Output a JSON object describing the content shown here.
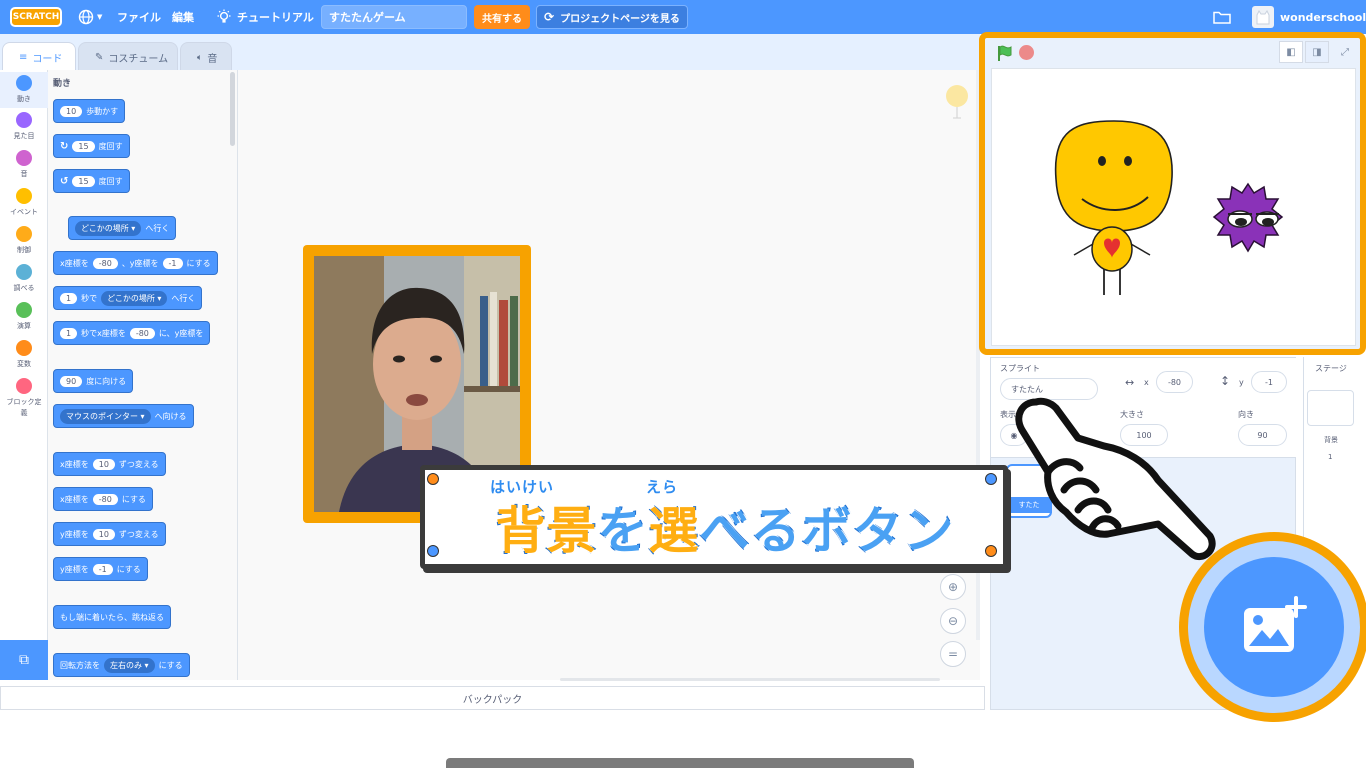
{
  "menubar": {
    "logo": "SCRATCH",
    "file": "ファイル",
    "edit": "編集",
    "tutorial": "チュートリアル",
    "project_title": "すたたんゲーム",
    "share": "共有する",
    "see_project_page": "プロジェクトページを見る",
    "username": "wonderschool"
  },
  "tabs": {
    "code": "コード",
    "costumes": "コスチューム",
    "sounds": "音"
  },
  "categories": [
    {
      "label": "動き",
      "color": "#4c97ff"
    },
    {
      "label": "見た目",
      "color": "#9966ff"
    },
    {
      "label": "音",
      "color": "#cf63cf"
    },
    {
      "label": "イベント",
      "color": "#ffbf00"
    },
    {
      "label": "制御",
      "color": "#ffab19"
    },
    {
      "label": "調べる",
      "color": "#5cb1d6"
    },
    {
      "label": "演算",
      "color": "#59c059"
    },
    {
      "label": "変数",
      "color": "#ff8c1a"
    },
    {
      "label": "ブロック定義",
      "color": "#ff6680"
    }
  ],
  "palette": {
    "heading": "動き",
    "move": {
      "n": "10",
      "t": "歩動かす"
    },
    "turn_right": {
      "n": "15",
      "t": "度回す"
    },
    "turn_left": {
      "n": "15",
      "t": "度回す"
    },
    "goto": {
      "d": "どこかの場所",
      "t": "へ行く"
    },
    "gotoxy": {
      "a": "x座標を",
      "x": "-80",
      "b": "、y座標を",
      "y": "-1",
      "c": "にする"
    },
    "glide": {
      "n": "1",
      "a": "秒で",
      "d": "どこかの場所",
      "t": "へ行く"
    },
    "glidexy": {
      "n": "1",
      "a": "秒でx座標を",
      "x": "-80",
      "b": "に、y座標を"
    },
    "point_dir": {
      "n": "90",
      "t": "度に向ける"
    },
    "point_towards": {
      "d": "マウスのポインター",
      "t": "へ向ける"
    },
    "change_x": {
      "a": "x座標を",
      "n": "10",
      "t": "ずつ変える"
    },
    "set_x": {
      "a": "x座標を",
      "n": "-80",
      "t": "にする"
    },
    "change_y": {
      "a": "y座標を",
      "n": "10",
      "t": "ずつ変える"
    },
    "set_y": {
      "a": "y座標を",
      "n": "-1",
      "t": "にする"
    },
    "bounce": "もし端に着いたら、跳ね返る",
    "rotation": {
      "a": "回転方法を",
      "d": "左右のみ",
      "t": "にする"
    }
  },
  "backpack": "バックパック",
  "sprite_info": {
    "sprite_label": "スプライト",
    "sprite_name": "すたたん",
    "x_label": "x",
    "x_value": "-80",
    "y_label": "y",
    "y_value": "-1",
    "show_label": "表示す",
    "size_label": "大きさ",
    "size_value": "100",
    "direction_label": "向き",
    "direction_value": "90",
    "tile_name": "すたた"
  },
  "stage_panel": {
    "label": "ステージ",
    "backdrops_label": "背景",
    "backdrops_count": "1"
  },
  "caption": {
    "ruby_1": "はいけい",
    "ruby_2": "えら",
    "part1": "背景",
    "part2": "を",
    "part3": "選",
    "part4": "べるボタン"
  },
  "colors": {
    "accent": "#4c97ff",
    "highlight": "#f7a200",
    "share": "#ff8c1a"
  }
}
